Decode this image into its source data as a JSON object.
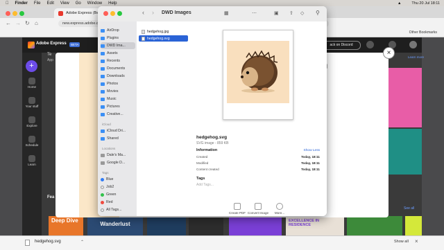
{
  "menubar": {
    "app": "Finder",
    "items": [
      "File",
      "Edit",
      "View",
      "Go",
      "Window",
      "Help"
    ],
    "datetime": "Thu 20 Jul  18:11"
  },
  "browser": {
    "tab_title": "Adobe Express (Beta)",
    "url": "new.express.adobe.com",
    "other_bookmarks": "Other Bookmarks"
  },
  "adobe": {
    "beta": "BETA",
    "discord": "ack on Discord",
    "learn_more": "Learn more",
    "sidebar": [
      "Home",
      "Your stuff",
      "Explore",
      "Schedule",
      "Learn"
    ],
    "text_partial": [
      "Te",
      "App"
    ],
    "heading_partial": "Fea",
    "see_all": "See all",
    "tiles": [
      "Deep Dive",
      "Wanderlust",
      "EXCELLENCE IN RESIDENCE"
    ],
    "accent": "#6c4ce8"
  },
  "finder": {
    "title": "DWD Images",
    "sidebar_top": [
      "AirDrop",
      "Plugins",
      "DWD Ima...",
      "Assets",
      "Recents",
      "Documents",
      "Downloads",
      "Photos",
      "Movies",
      "Music",
      "Pictures",
      "Creative..."
    ],
    "icloud_head": "iCloud",
    "icloud": [
      "iCloud Dri...",
      "Shared"
    ],
    "locations_head": "Locations",
    "locations": [
      "Dale's Ma...",
      "Google D..."
    ],
    "tags_head": "Tags",
    "tags": [
      {
        "name": "Blue",
        "color": "#2f7cf6"
      },
      {
        "name": "Job2",
        "color": "#bdbdbd"
      },
      {
        "name": "Green",
        "color": "#33c24d"
      },
      {
        "name": "Red",
        "color": "#f04a3e"
      },
      {
        "name": "All Tags...",
        "color": "#bdbdbd"
      }
    ],
    "files": [
      "hedgehog.jpg",
      "hedgehog.svg"
    ],
    "preview": {
      "filename": "hedgehog.svg",
      "kind": "SVG image - 859 KB",
      "information": "Information",
      "show_less": "Show Less",
      "rows": [
        {
          "label": "Created",
          "value": "Today, 18:11"
        },
        {
          "label": "Modified",
          "value": "Today, 18:11"
        },
        {
          "label": "Content created",
          "value": "Today, 18:11"
        }
      ],
      "tags_label": "Tags",
      "add_tags": "Add Tags...",
      "actions": [
        "Create PDF",
        "Convert Image",
        "More..."
      ]
    }
  },
  "downloads": {
    "file": "hedgehog.svg",
    "show_all": "Show all"
  }
}
